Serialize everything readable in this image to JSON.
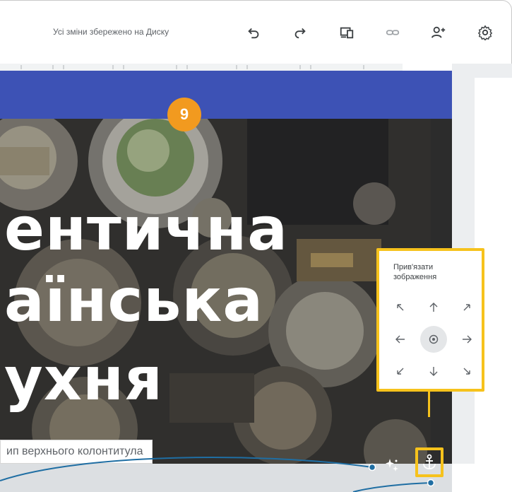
{
  "toolbar": {
    "status_text": "Усі зміни збережено на Диску",
    "icons": [
      "undo-icon",
      "redo-icon",
      "preview-device-icon",
      "link-icon",
      "share-add-person-icon",
      "settings-gear-icon"
    ]
  },
  "hero": {
    "line1": "ентична",
    "line2": "аїнська",
    "line3": "ухня"
  },
  "header_chip": {
    "label": "ип верхнього колонтитула"
  },
  "callout": {
    "number": "9"
  },
  "anchor_panel": {
    "title": "Прив'язати зображення",
    "arrows": [
      "arrow-up-left",
      "arrow-up",
      "arrow-up-right",
      "arrow-left",
      "center-target",
      "arrow-right",
      "arrow-down-left",
      "arrow-down",
      "arrow-down-right"
    ],
    "selected": "center-target"
  },
  "colors": {
    "header_band": "#3d52b5",
    "highlight": "#f6c21c",
    "badge": "#f29a1f",
    "callout_line": "#1f6ea3"
  }
}
